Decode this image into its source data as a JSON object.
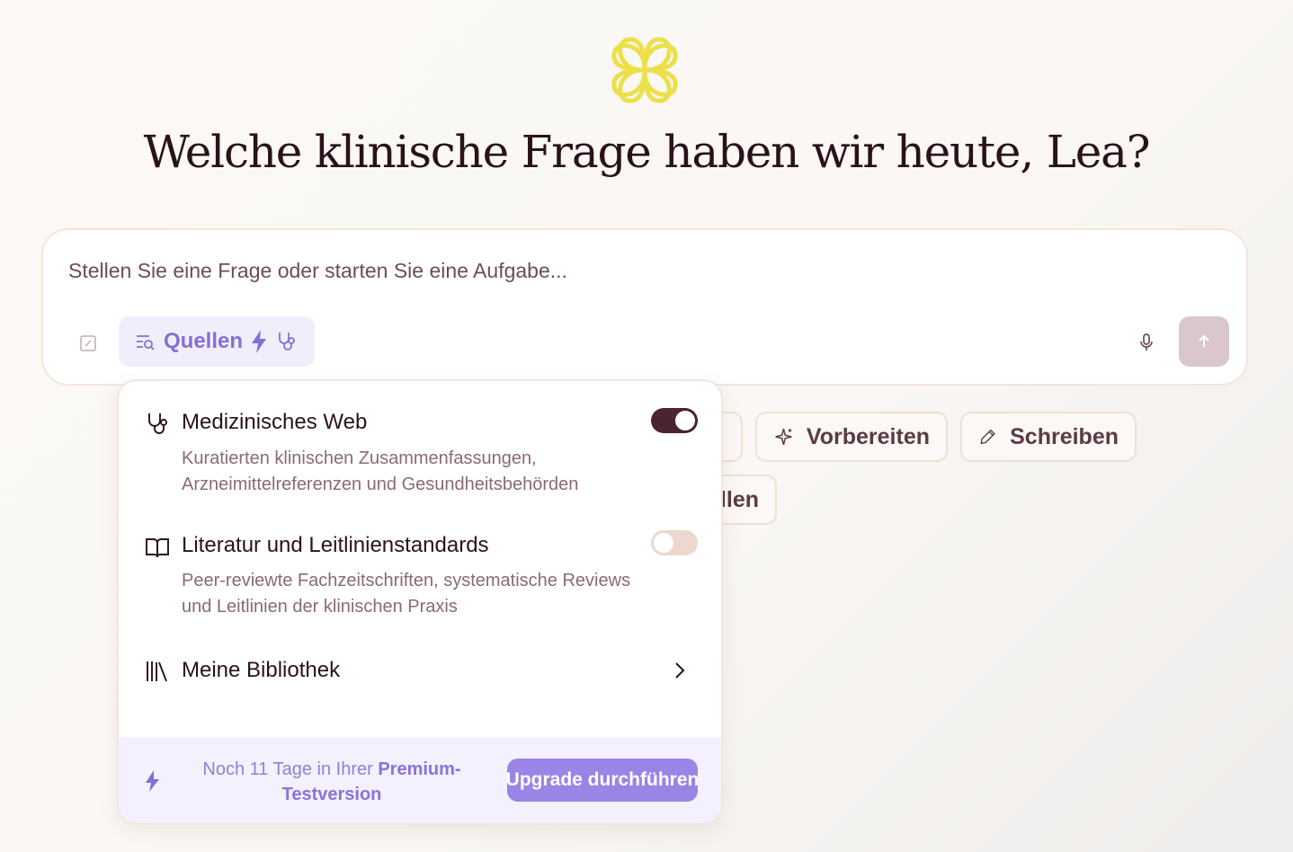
{
  "greeting": "Welche klinische Frage haben wir heute, Lea?",
  "composer": {
    "placeholder": "Stellen Sie eine Frage oder starten Sie eine Aufgabe...",
    "sources_label": "Quellen"
  },
  "chips": {
    "prepare": "Vorbereiten",
    "write": "Schreiben",
    "partial_chip": "llen"
  },
  "sources_menu": {
    "items": [
      {
        "title": "Medizinisches Web",
        "description": "Kuratierten klinischen Zusammenfassungen, Arzneimittelreferenzen und Gesundheitsbehörden",
        "enabled": true
      },
      {
        "title": "Literatur und Leitlinienstandards",
        "description": "Peer-reviewte Fachzeitschriften, systematische Reviews und Leitlinien der klinischen Praxis",
        "enabled": false
      },
      {
        "title": "Meine Bibliothek"
      }
    ],
    "footer": {
      "trial_prefix": "Noch 11 Tage in Ihrer ",
      "trial_emphasis": "Premium-Testversion",
      "upgrade_label": "Upgrade durchführen"
    }
  },
  "colors": {
    "accent_purple": "#8470d4",
    "toggle_on": "#4a2530",
    "toggle_off": "#ecd8cc",
    "logo_yellow": "#ece04a"
  },
  "icons": {
    "logo": "quatrefoil-logo-icon",
    "attach": "attach-icon",
    "sources": "search-list-icon",
    "bolt": "bolt-icon",
    "stethoscope": "stethoscope-icon",
    "mic": "microphone-icon",
    "send": "arrow-up-icon",
    "sparkles": "sparkles-icon",
    "pencil": "pencil-icon",
    "book": "book-open-icon",
    "library": "library-icon",
    "chevron": "chevron-right-icon"
  }
}
